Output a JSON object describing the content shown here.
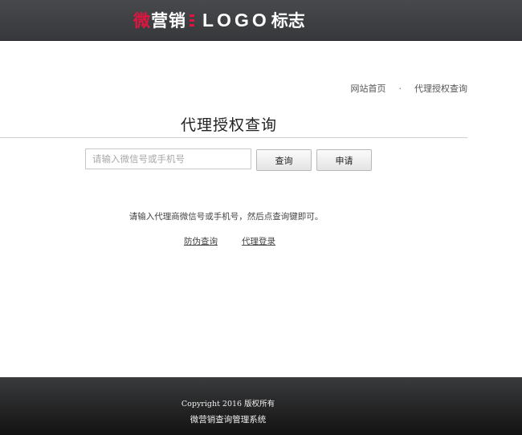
{
  "header": {
    "logo": {
      "highlight_char": "微",
      "rest_chars": "营销",
      "latin": "LOGO",
      "suffix": "标志"
    }
  },
  "breadcrumb": {
    "home": "网站首页",
    "separator": "·",
    "current": "代理授权查询"
  },
  "main": {
    "title": "代理授权查询",
    "search": {
      "value": "",
      "placeholder": "请输入微信号或手机号"
    },
    "query_button": "查询",
    "apply_button": "申请",
    "hint": "请输入代理商微信号或手机号，然后点查询键即可。",
    "links": {
      "anti_fake": "防伪查询",
      "agent_login": "代理登录"
    }
  },
  "footer": {
    "copyright": "Copyright 2016 版权所有",
    "system_name": "微营销查询管理系统"
  },
  "colors": {
    "accent": "#e0153f",
    "header_bg": "#404245",
    "footer_bg": "#1e1e1e"
  }
}
